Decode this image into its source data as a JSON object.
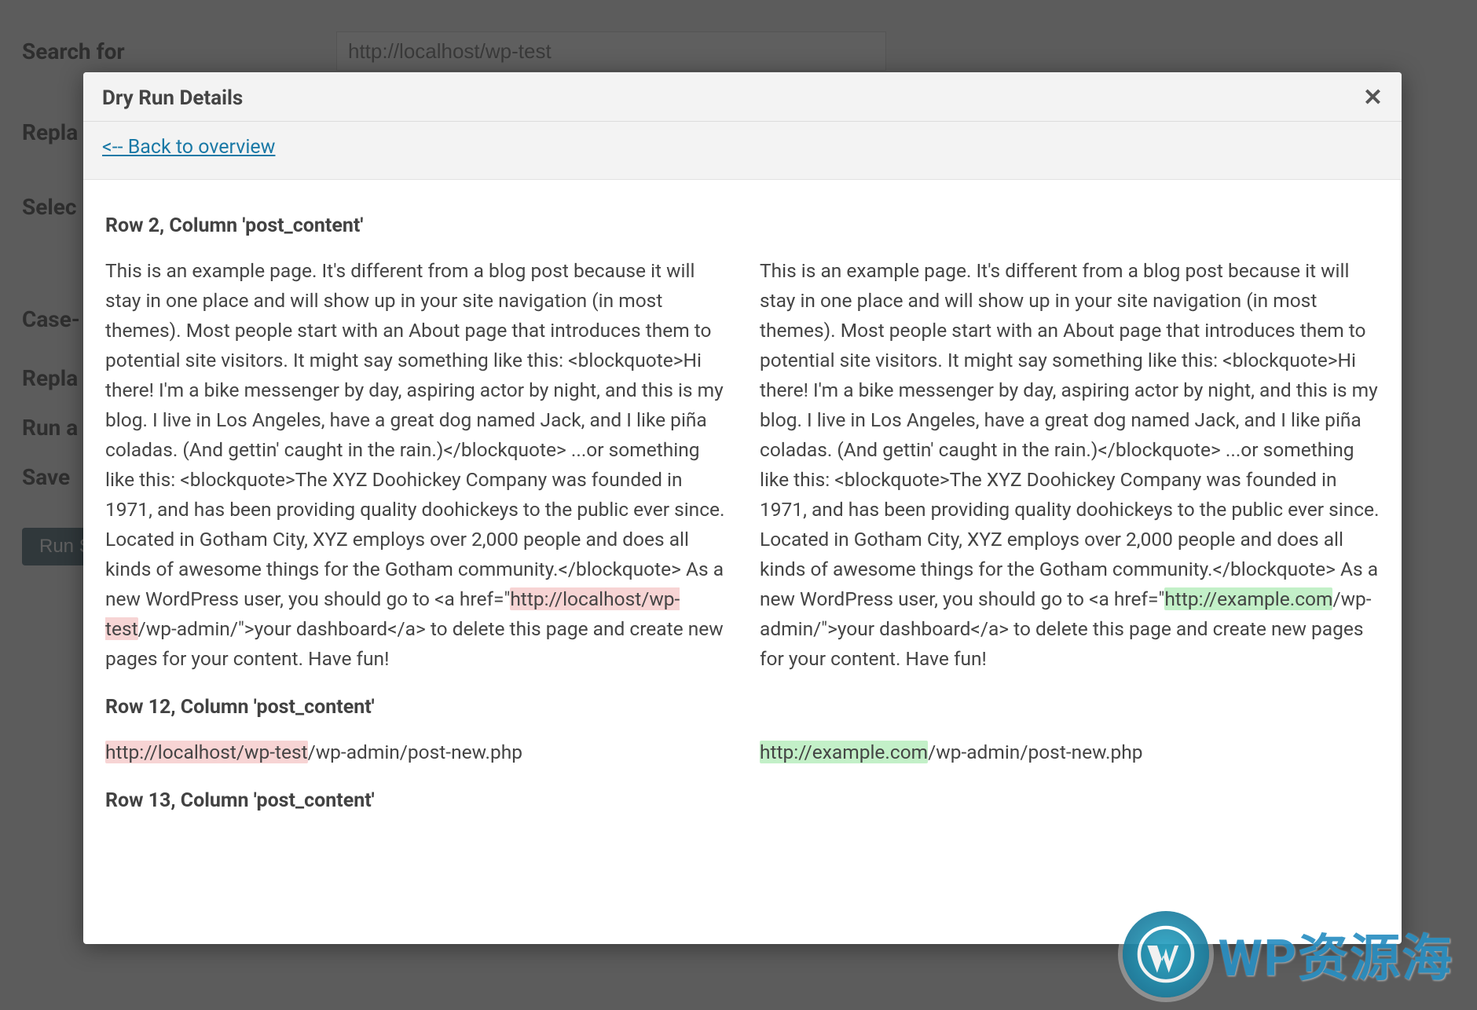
{
  "background": {
    "search_label": "Search for",
    "search_value": "http://localhost/wp-test",
    "replace_label": "Repla",
    "select_label": "Selec",
    "case_label": "Case-",
    "repla2_label": "Repla",
    "run_label": "Run a",
    "save_label": "Save ",
    "button_label": "Run S"
  },
  "modal": {
    "title": "Dry Run Details",
    "back_link": "<-- Back to overview",
    "sections": [
      {
        "title": "Row 2, Column 'post_content'",
        "text_pre": "This is an example page. It's different from a blog post because it will stay in one place and will show up in your site navigation (in most themes). Most people start with an About page that introduces them to potential site visitors. It might say something like this: <blockquote>Hi there! I'm a bike messenger by day, aspiring actor by night, and this is my blog. I live in Los Angeles, have a great dog named Jack, and I like piña coladas. (And gettin' caught in the rain.)</blockquote> ...or something like this: <blockquote>The XYZ Doohickey Company was founded in 1971, and has been providing quality doohickeys to the public ever since. Located in Gotham City, XYZ employs over 2,000 people and does all kinds of awesome things for the Gotham community.</blockquote> As a new WordPress user, you should go to <a href=\"",
        "old_val": "http://localhost/wp-test",
        "new_val": "http://example.com",
        "text_post": "/wp-admin/\">your dashboard</a> to delete this page and create new pages for your content. Have fun!"
      },
      {
        "title": "Row 12, Column 'post_content'",
        "old_val": "http://localhost/wp-test",
        "new_val": "http://example.com",
        "text_post": "/wp-admin/post-new.php"
      },
      {
        "title": "Row 13, Column 'post_content'"
      }
    ]
  },
  "watermark": {
    "text": "WP资源海"
  }
}
